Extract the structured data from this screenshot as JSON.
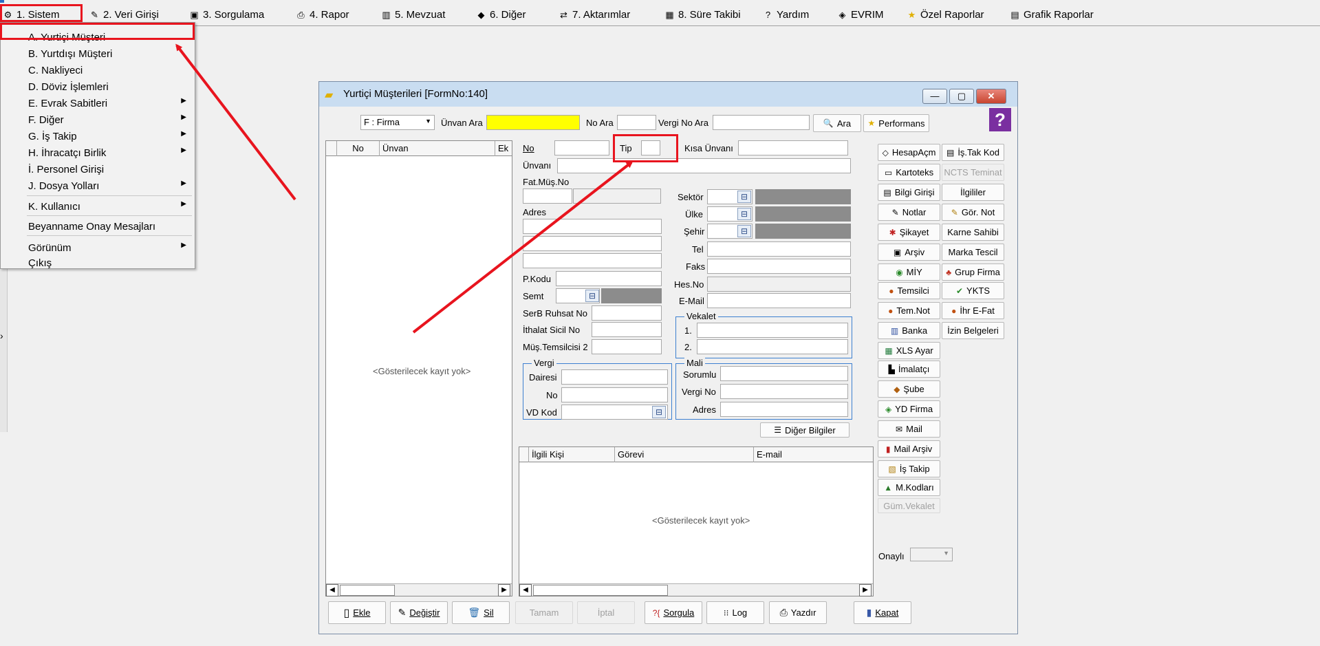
{
  "menu": {
    "items": [
      {
        "label": "1.  Sistem",
        "icon": "sistem-icon"
      },
      {
        "label": "2.  Veri Girişi",
        "icon": "edit-icon"
      },
      {
        "label": "3.  Sorgulama",
        "icon": "query-icon"
      },
      {
        "label": "4.  Rapor",
        "icon": "printer-icon"
      },
      {
        "label": "5.  Mevzuat",
        "icon": "books-icon"
      },
      {
        "label": "6.  Diğer",
        "icon": "shapes-icon"
      },
      {
        "label": "7.  Aktarımlar",
        "icon": "transfer-icon"
      },
      {
        "label": "8. Süre Takibi",
        "icon": "calendar-icon"
      },
      {
        "label": "Yardım",
        "icon": "help-icon"
      },
      {
        "label": "EVRIM",
        "icon": "evrim-icon"
      },
      {
        "label": "Özel Raporlar",
        "icon": "star-icon"
      },
      {
        "label": "Grafik Raporlar",
        "icon": "chart-icon"
      }
    ]
  },
  "dropdown": {
    "items": [
      {
        "label": "A.  Yurtiçi Müşteri",
        "submenu": false
      },
      {
        "label": "B.  Yurtdışı Müşteri",
        "submenu": false
      },
      {
        "label": "C.  Nakliyeci",
        "submenu": false
      },
      {
        "label": "D.   Döviz İşlemleri",
        "submenu": false
      },
      {
        "label": "E.  Evrak Sabitleri",
        "submenu": true
      },
      {
        "label": "F.  Diğer",
        "submenu": true
      },
      {
        "label": "G.  İş Takip",
        "submenu": true
      },
      {
        "label": "H.   İhracatçı Birlik",
        "submenu": true
      },
      {
        "label": "İ.    Personel Girişi",
        "submenu": false
      },
      {
        "label": "J.   Dosya Yolları",
        "submenu": true
      },
      {
        "label": "K.  Kullanıcı",
        "submenu": true
      },
      {
        "label": "Beyanname Onay Mesajları",
        "submenu": false
      },
      {
        "label": "Görünüm",
        "submenu": true
      },
      {
        "label": "Çıkış",
        "submenu": false
      }
    ]
  },
  "window": {
    "title": "Yurtiçi Müşterileri [FormNo:140]",
    "help_glyph": "?",
    "close_glyph": "✕"
  },
  "search": {
    "type_select": "F : Firma",
    "unvan_ara_label": "Ünvan Ara",
    "unvan_ara_value": "",
    "no_ara_label": "No Ara",
    "no_ara_value": "",
    "vergi_no_ara_label": "Vergi No Ara",
    "vergi_no_ara_value": "",
    "ara_label": "Ara",
    "performans_label": "Performans"
  },
  "list_grid": {
    "columns": [
      "No",
      "Ünvan",
      "Ek"
    ],
    "empty_text": "<Gösterilecek kayıt yok>"
  },
  "form": {
    "no_label": "No",
    "tip_label": "Tip",
    "kisa_unvani_label": "Kısa Ünvanı",
    "unvani_label": "Ünvanı",
    "fat_mus_no_label": "Fat.Müş.No",
    "adres_label": "Adres",
    "sektor_label": "Sektör",
    "ulke_label": "Ülke",
    "sehir_label": "Şehir",
    "tel_label": "Tel",
    "faks_label": "Faks",
    "hes_no_label": "Hes.No",
    "email_label": "E-Mail",
    "p_kodu_label": "P.Kodu",
    "semt_label": "Semt",
    "serb_ruhsat_label": "SerB Ruhsat No",
    "ithalat_sicil_label": "İthalat Sicil No",
    "mus_temsilcisi_label": "Müş.Temsilcisi 2",
    "vekalet_title": "Vekalet",
    "vekalet_1": "1.",
    "vekalet_2": "2.",
    "vergi_title": "Vergi",
    "vergi_dairesi_label": "Dairesi",
    "vergi_no_label": "No",
    "vd_kod_label": "VD Kod",
    "mali_title": "Mali",
    "mali_sorumlu_label": "Sorumlu",
    "mali_vergi_no_label": "Vergi No",
    "mali_adres_label": "Adres",
    "diger_bilgiler_label": "Diğer Bilgiler"
  },
  "contact_grid": {
    "columns": [
      "İlgili Kişi",
      "Görevi",
      "E-mail"
    ],
    "empty_text": "<Gösterilecek kayıt yok>"
  },
  "side_buttons": {
    "left": [
      {
        "label": "HesapAçm",
        "icon": "eraser-icon",
        "enabled": true
      },
      {
        "label": "Kartoteks",
        "icon": "card-icon",
        "enabled": true
      },
      {
        "label": "Bilgi Girişi",
        "icon": "document-icon",
        "enabled": true
      },
      {
        "label": "Notlar",
        "icon": "notes-icon",
        "enabled": true
      },
      {
        "label": "Şikayet",
        "icon": "complaint-icon",
        "enabled": true
      },
      {
        "label": "Arşiv",
        "icon": "archive-icon",
        "enabled": true
      },
      {
        "label": "MİY",
        "icon": "miy-icon",
        "enabled": true
      },
      {
        "label": "Temsilci",
        "icon": "people-icon",
        "enabled": true
      },
      {
        "label": "Tem.Not",
        "icon": "people-note-icon",
        "enabled": true
      },
      {
        "label": "Banka",
        "icon": "bank-icon",
        "enabled": true
      },
      {
        "label": "XLS Ayar",
        "icon": "excel-icon",
        "enabled": true
      },
      {
        "label": "İmalatçı",
        "icon": "factory-icon",
        "enabled": true
      },
      {
        "label": "Şube",
        "icon": "branch-icon",
        "enabled": true
      },
      {
        "label": "YD Firma",
        "icon": "foreign-firm-icon",
        "enabled": true
      },
      {
        "label": "Mail",
        "icon": "mail-icon",
        "enabled": true
      },
      {
        "label": "Mail Arşiv",
        "icon": "mailbox-icon",
        "enabled": true
      },
      {
        "label": "İş Takip",
        "icon": "task-icon",
        "enabled": true
      },
      {
        "label": "M.Kodları",
        "icon": "codes-icon",
        "enabled": true
      },
      {
        "label": "Güm.Vekalet",
        "icon": "",
        "enabled": false
      }
    ],
    "right": [
      {
        "label": "İş.Tak Kod",
        "icon": "task-code-icon",
        "enabled": true
      },
      {
        "label": "NCTS Teminat",
        "icon": "",
        "enabled": false
      },
      {
        "label": "İlgililer",
        "icon": "",
        "enabled": true
      },
      {
        "label": "Gör. Not",
        "icon": "view-note-icon",
        "enabled": true
      },
      {
        "label": "Karne Sahibi",
        "icon": "",
        "enabled": true
      },
      {
        "label": "Marka Tescil",
        "icon": "",
        "enabled": true
      },
      {
        "label": "Grup Firma",
        "icon": "group-icon",
        "enabled": true
      },
      {
        "label": "YKTS",
        "icon": "check-icon",
        "enabled": true
      },
      {
        "label": "İhr E-Fat",
        "icon": "invoice-icon",
        "enabled": true
      },
      {
        "label": "İzin Belgeleri",
        "icon": "",
        "enabled": true
      }
    ],
    "onayli_label": "Onaylı"
  },
  "bottom_buttons": [
    {
      "label": "Ekle",
      "icon": "add-doc-icon",
      "enabled": true
    },
    {
      "label": "Değiştir",
      "icon": "edit-icon",
      "enabled": true
    },
    {
      "label": "Sil",
      "icon": "trash-icon",
      "enabled": true
    },
    {
      "label": "Tamam",
      "icon": "",
      "enabled": false
    },
    {
      "label": "İptal",
      "icon": "",
      "enabled": false
    },
    {
      "label": "Sorgula",
      "icon": "query-icon",
      "enabled": true
    },
    {
      "label": "Log",
      "icon": "log-icon",
      "enabled": true
    },
    {
      "label": "Yazdır",
      "icon": "printer-icon",
      "enabled": true
    },
    {
      "label": "Kapat",
      "icon": "door-icon",
      "enabled": true
    }
  ]
}
